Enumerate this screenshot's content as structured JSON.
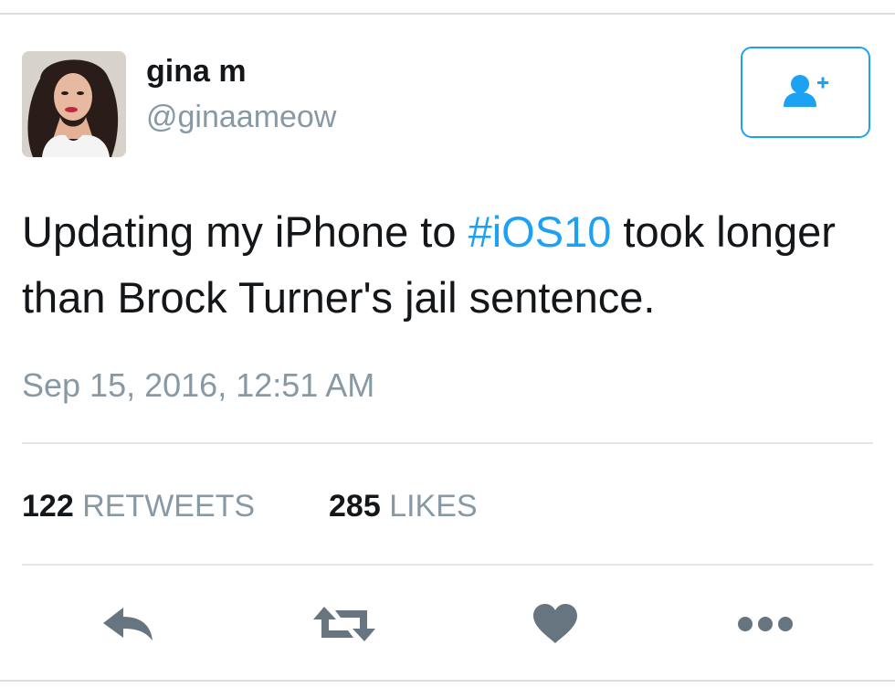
{
  "user": {
    "display_name": "gina m",
    "handle": "@ginaameow",
    "avatar_alt": "profile photo"
  },
  "follow_button": {
    "icon": "add-user-icon"
  },
  "tweet": {
    "text_before": "Updating my iPhone to ",
    "hashtag": "#iOS10",
    "text_after": " took longer than Brock Turner's jail sentence.",
    "timestamp": "Sep 15, 2016, 12:51 AM"
  },
  "stats": {
    "retweets_count": "122",
    "retweets_label": "RETWEETS",
    "likes_count": "285",
    "likes_label": "LIKES"
  },
  "actions": [
    {
      "icon": "reply-icon"
    },
    {
      "icon": "retweet-icon"
    },
    {
      "icon": "heart-icon"
    },
    {
      "icon": "more-icon"
    }
  ],
  "colors": {
    "link": "#1da1f2",
    "text": "#14171a",
    "muted": "#8899a6",
    "icon": "#66757f"
  }
}
